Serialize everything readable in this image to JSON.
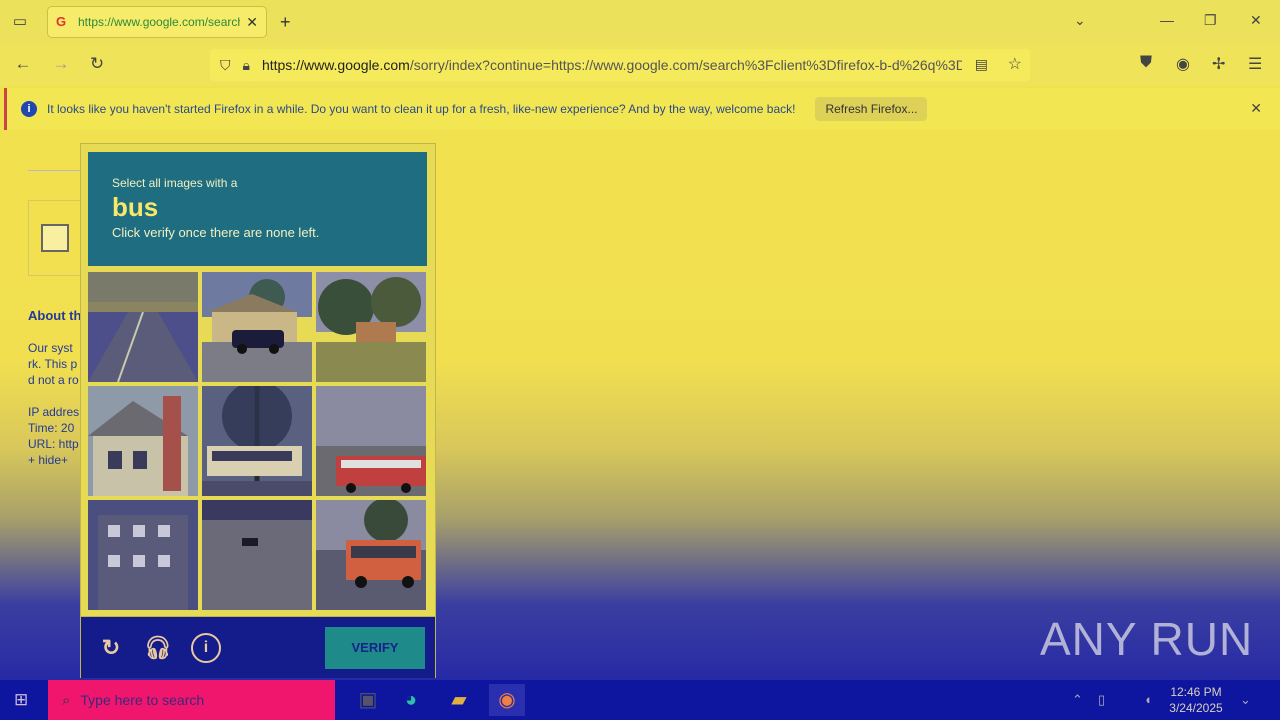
{
  "browser": {
    "tab_title": "https://www.google.com/search",
    "tab_favicon": "G",
    "url_host": "https://www.google.com",
    "url_rest": "/sorry/index?continue=https://www.google.com/search%3Fclient%3Dfirefox-b-d%26q%3D"
  },
  "notification": {
    "message": "It looks like you haven't started Firefox in a while. Do you want to clean it up for a fresh, like-new experience? And by the way, welcome back!",
    "button": "Refresh Firefox..."
  },
  "page": {
    "heading": "About th",
    "lines": [
      "Our syst",
      "rk. This p",
      "d not a ro",
      "IP addres",
      "Time: 20",
      "URL: http",
      "+ hide+"
    ]
  },
  "captcha": {
    "line1": "Select all images with a",
    "target": "bus",
    "line3": "Click verify once there are none left.",
    "verify_label": "VERIFY",
    "tiles": [
      {
        "scene": "road"
      },
      {
        "scene": "house-car"
      },
      {
        "scene": "yard-tree"
      },
      {
        "scene": "house-chimney"
      },
      {
        "scene": "tree-bus"
      },
      {
        "scene": "school-bus"
      },
      {
        "scene": "apartment"
      },
      {
        "scene": "road-car"
      },
      {
        "scene": "bus-side"
      }
    ]
  },
  "watermark": "ANY RUN",
  "taskbar": {
    "search_placeholder": "Type here to search",
    "time": "12:46 PM",
    "date": "3/24/2025"
  },
  "colors": {
    "captcha_header": "#1e6d80",
    "verify_button": "#1f8a8a",
    "taskbar": "#0e159e",
    "search_box": "#f0166e"
  }
}
